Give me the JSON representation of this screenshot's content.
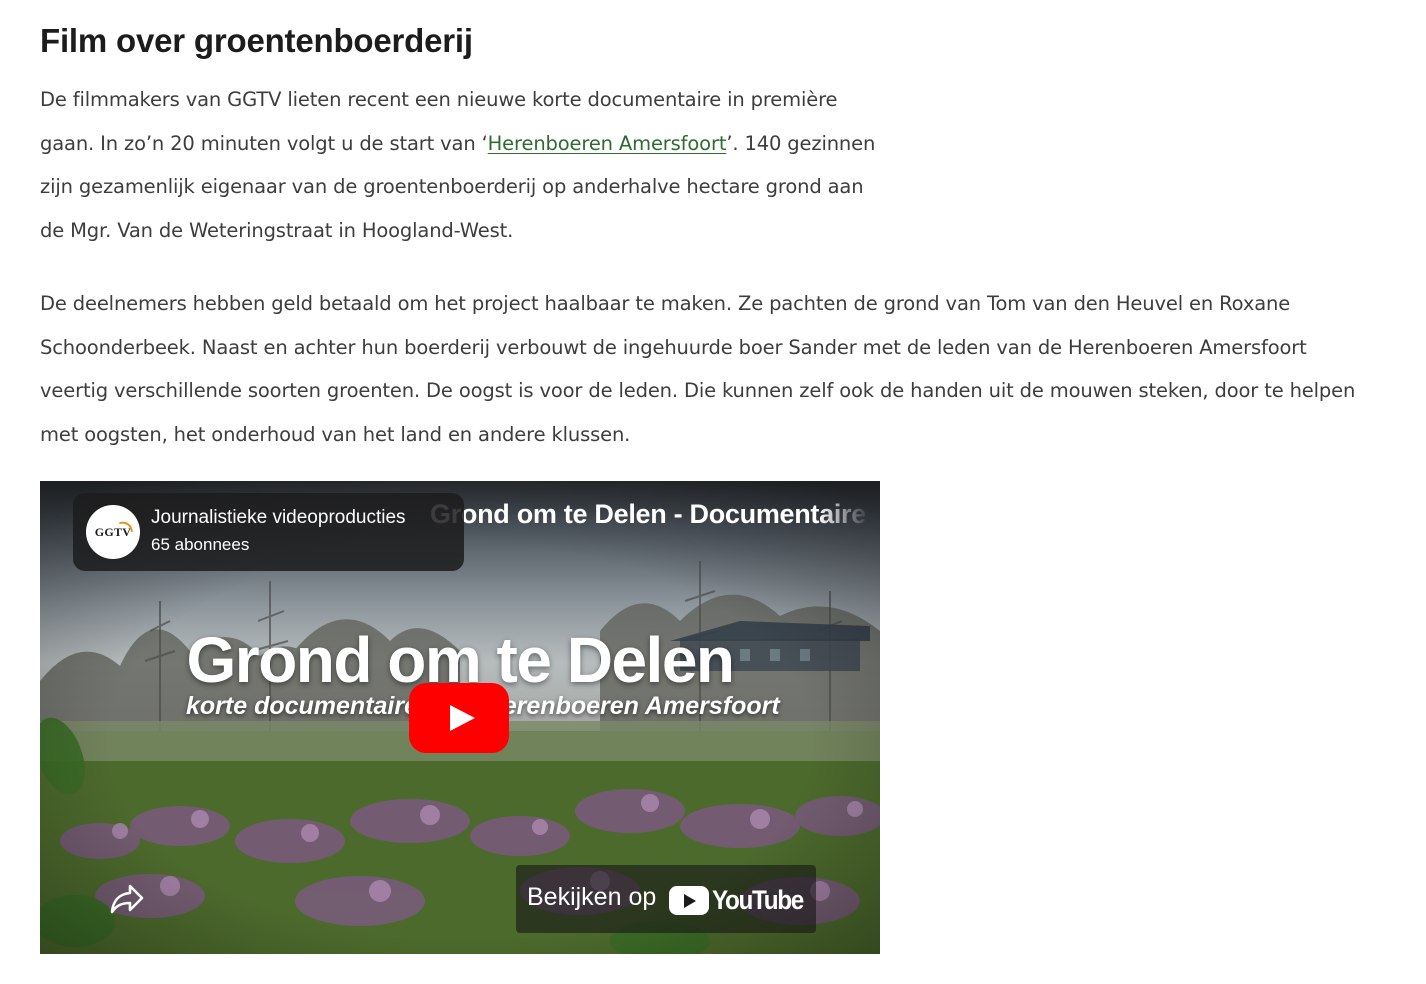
{
  "article": {
    "heading": "Film over groentenboerderij",
    "p1_before_link": "De filmmakers van GGTV lieten recent een nieuwe korte documentaire in première gaan.  In zo’n 20 minuten volgt u de start van ‘",
    "p1_link": "Herenboeren Amersfoort",
    "p1_after_link": "’. 140 gezinnen zijn gezamenlijk eigenaar van de groentenboerderij op anderhalve hectare grond aan de Mgr. Van de Weteringstraat in Hoogland-West.",
    "p2": "De deelnemers hebben geld betaald om het project haalbaar te maken. Ze pachten de grond van Tom van den Heuvel en Roxane Schoonderbeek. Naast en achter hun boerderij verbouwt de ingehuurde boer Sander met de leden van de Herenboeren Amersfoort veertig verschillende soorten groenten. De oogst is voor de leden. Die kunnen zelf ook de handen uit de mouwen steken, door te helpen met oogsten, het onderhoud van het land en andere klussen."
  },
  "video": {
    "channel_logo_text": "GGTV",
    "channel_name": "Journalistieke videoproducties",
    "subscribers": "65 abonnees",
    "title": "Grond om te Delen - Documentaire Herenboeren Amersfoort",
    "thumbnail_headline": "Grond om te Delen",
    "thumbnail_subtitle": "korte documentaire over Herenboeren Amersfoort",
    "watch_label": "Bekijken op",
    "youtube_wordmark": "YouTube",
    "play_icon": "play-icon",
    "share_icon": "share-icon"
  },
  "colors": {
    "link": "#2f6a31",
    "text": "#3d3d3d",
    "heading": "#1c1c1c",
    "play_button": "#ff0000"
  }
}
